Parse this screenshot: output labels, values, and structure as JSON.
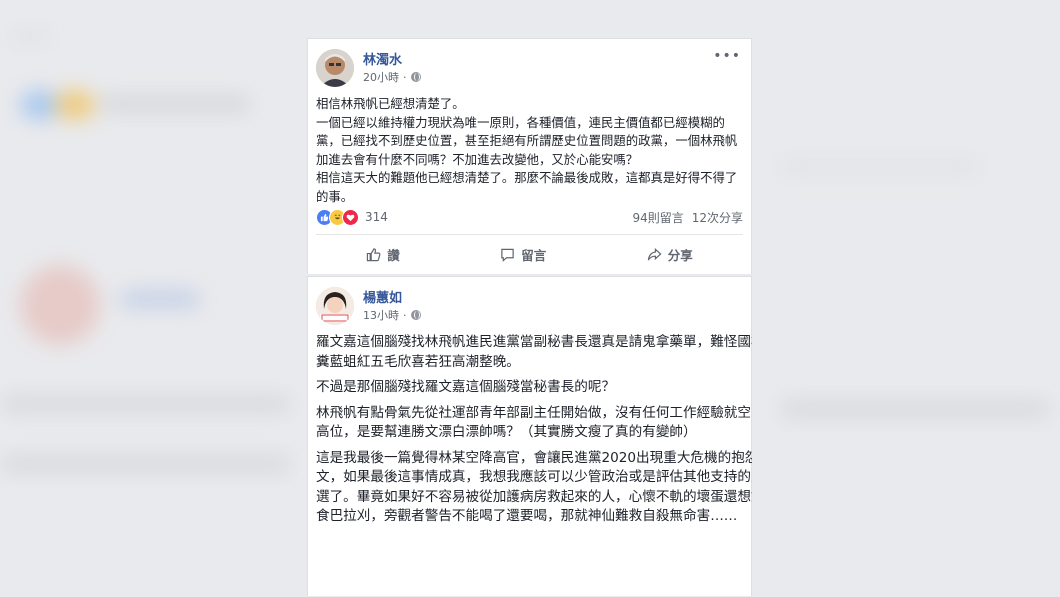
{
  "colors": {
    "link": "#365899",
    "text": "#1d2129",
    "muted": "#616770",
    "page_bg": "#e9eaed"
  },
  "posts": [
    {
      "author": "林濁水",
      "time": "20小時",
      "more_label": "•••",
      "body": "相信林飛帆已經想清楚了。\n一個已經以維持權力現狀為唯一原則，各種價值，連民主價值都已經模糊的黨，已經找不到歷史位置，甚至拒絕有所謂歷史位置問題的政黨，一個林飛帆加進去會有什麼不同嗎？不加進去改變他，又於心能安嗎？\n相信這天大的難題他已經想清楚了。那麼不論最後成敗，這都真是好得不得了的事。",
      "reactions": {
        "icons": [
          "like-icon",
          "haha-icon",
          "love-icon"
        ],
        "count": "314"
      },
      "comments": "94則留言",
      "shares": "12次分享",
      "actions": {
        "like": "讚",
        "comment": "留言",
        "share": "分享"
      }
    },
    {
      "author": "楊蕙如",
      "time": "13小時",
      "avatar_badge": "反送中",
      "paragraphs": [
        "羅文嘉這個腦殘找林飛帆進民進黨當副秘書長還真是請鬼拿藥單，難怪國柯糞藍蛆紅五毛欣喜若狂高潮整晚。",
        "不過是那個腦殘找羅文嘉這個腦殘當秘書長的呢？",
        "林飛帆有點骨氣先從社運部青年部副主任開始做，沒有任何工作經驗就空降高位，是要幫連勝文漂白漂帥嗎？（其實勝文瘦了真的有變帥）",
        "這是我最後一篇覺得林某空降高官，會讓民進黨2020出現重大危機的抱怨文，如果最後這事情成真，我想我應該可以少管政治或是評估其他支持的人選了。畢竟如果好不容易被從加護病房救起來的人，心懷不軌的壞蛋還想餵食巴拉刈，旁觀者警告不能喝了還要喝，那就神仙難救自殺無命害……"
      ]
    }
  ]
}
